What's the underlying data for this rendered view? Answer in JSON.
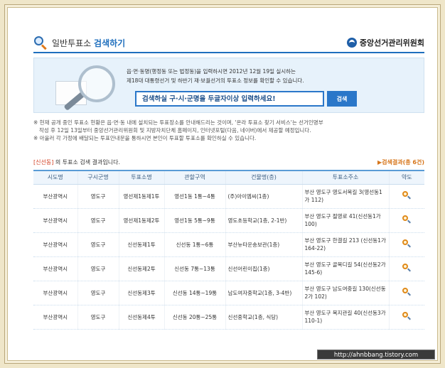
{
  "header": {
    "title_prefix": "일반투표소",
    "title_accent": "검색하기",
    "brand": "중앙선거관리위원회"
  },
  "search": {
    "desc_line1": "읍·면·동명(행정동 또는 법정동)을 입력하시면 2012년 12월 19일 실시하는",
    "desc_line2": "제18대 대통령선거 및 하반기 재·보궐선거의 투표소 정보를 확인할 수 있습니다.",
    "placeholder": "검색하실 구·시·군명을 두글자이상 입력하세요!",
    "button": "검색"
  },
  "notes": {
    "line1": "※ 현재 공개 중인 투표소 현황은 읍·면·동 내에 설치되는 투표장소를 안내해드리는 것이며, '온라 투표소 찾기 서비스'는 선거인명부",
    "line2": "작성 후 12일 13일부터 중앙선거관리위원회 및 지방자치단체 홈페이지, 인터넷포털(다음, 네이버)에서 제공할 예정입니다.",
    "line3": "※ 아울러 각 가정에 배달되는 투표안내문을 통하시면 본인이 투표할 투표소를 확인하실 수 있습니다."
  },
  "results": {
    "location": "[신선동]",
    "suffix": " 의 투표소 검색 결과입니다.",
    "count": "▶검색결과(총 6건)"
  },
  "table": {
    "headers": [
      "시도명",
      "구시군명",
      "투표소명",
      "관할구역",
      "건물명(층)",
      "투표소주소",
      "약도"
    ],
    "rows": [
      [
        "부산광역시",
        "영도구",
        "영선제1동제1투",
        "영선1동 1통~4통",
        "(주)아이엠씨(1층)",
        "부산 영도구 영도서복길 3(영선동1가 112)"
      ],
      [
        "부산광역시",
        "영도구",
        "영선제1동제2투",
        "영선1동 5통~9통",
        "영도초등학교(1층, 2-1반)",
        "부산 영도구 절영로 41(신선동1가 100)"
      ],
      [
        "부산광역시",
        "영도구",
        "신선동제1투",
        "신선동 1통~6통",
        "부산뉴타운송보관(1층)",
        "부산 영도구 한결길 213 (신선동1가 164-22)"
      ],
      [
        "부산광역시",
        "영도구",
        "신선동제2투",
        "신선동 7통~13통",
        "신선어린이집(1층)",
        "부산 영도구 골목디길 54(신선동2가 145-6)"
      ],
      [
        "부산광역시",
        "영도구",
        "신선동제3투",
        "신선동 14통~19통",
        "남도여자중학교(1층, 3-4반)",
        "부산 영도구 남도여중길 130(신선동2가 102)"
      ],
      [
        "부산광역시",
        "영도구",
        "신선동제4투",
        "신선동 20통~25통",
        "신선중학교(1층, 식당)",
        "부산 영도구 복지관길 40(신선동3가 110-1)"
      ]
    ]
  },
  "watermark": "http://ahnbbang.tistory.com"
}
